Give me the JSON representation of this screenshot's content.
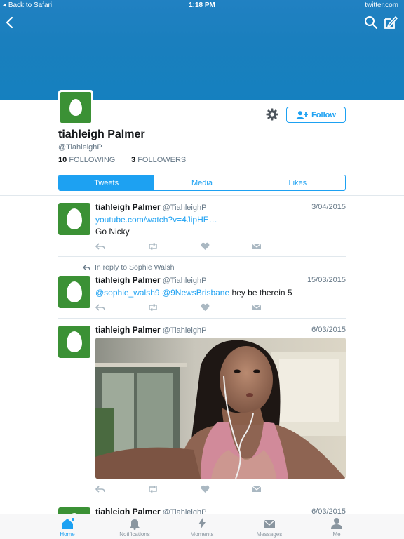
{
  "status_bar": {
    "back_label": "Back to Safari",
    "time": "1:18 PM",
    "host": "twitter.com"
  },
  "profile": {
    "name": "tiahleigh Palmer",
    "handle": "@TiahleighP",
    "following_count": "10",
    "following_label": "FOLLOWING",
    "followers_count": "3",
    "followers_label": "FOLLOWERS",
    "follow_label": "Follow"
  },
  "tabs": [
    {
      "label": "Tweets",
      "active": true
    },
    {
      "label": "Media",
      "active": false
    },
    {
      "label": "Likes",
      "active": false
    }
  ],
  "tweets": [
    {
      "name": "tiahleigh Palmer",
      "handle": "@TiahleighP",
      "date": "3/04/2015",
      "link": "youtube.com/watch?v=4JipHE…",
      "text": "Go Nicky"
    },
    {
      "reply_context": "In reply to Sophie Walsh",
      "name": "tiahleigh Palmer",
      "handle": "@TiahleighP",
      "date": "15/03/2015",
      "mention1": "@sophie_walsh9",
      "mention2": "@9NewsBrisbane",
      "text": "hey be therein 5"
    },
    {
      "name": "tiahleigh Palmer",
      "handle": "@TiahleighP",
      "date": "6/03/2015",
      "has_media": true
    },
    {
      "name": "tiahleigh Palmer",
      "handle": "@TiahleighP",
      "date": "6/03/2015"
    }
  ],
  "tab_bar": [
    {
      "label": "Home",
      "icon": "home-icon",
      "active": true
    },
    {
      "label": "Notifications",
      "icon": "bell-icon",
      "active": false
    },
    {
      "label": "Moments",
      "icon": "lightning-icon",
      "active": false
    },
    {
      "label": "Messages",
      "icon": "envelope-icon",
      "active": false
    },
    {
      "label": "Me",
      "icon": "person-icon",
      "active": false
    }
  ],
  "colors": {
    "brand_blue": "#1da1f2",
    "banner": "#1a7fbe",
    "egg_green": "#3b9135"
  }
}
